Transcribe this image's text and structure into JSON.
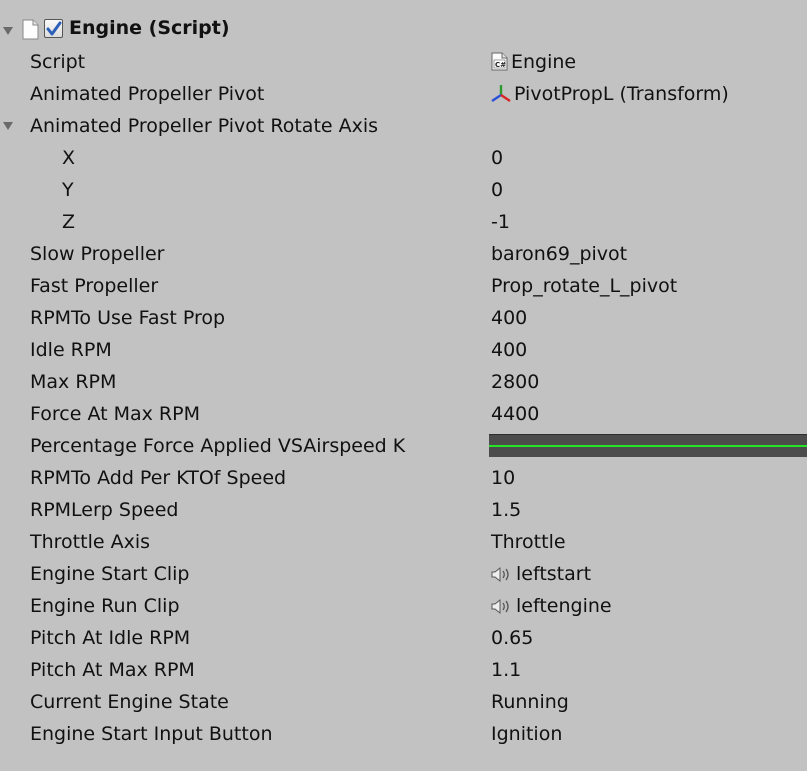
{
  "component": {
    "title": "Engine (Script)",
    "enabled": true,
    "icon": "file-icon",
    "checkbox_icon": "checkmark-icon"
  },
  "fields": {
    "script": {
      "label": "Script",
      "value": "Engine",
      "icon": "csharp-script-icon"
    },
    "pivot": {
      "label": "Animated Propeller Pivot",
      "value": "PivotPropL (Transform)",
      "icon": "transform-icon"
    },
    "rotate_axis": {
      "label": "Animated Propeller Pivot Rotate Axis"
    },
    "axis_x": {
      "label": "X",
      "value": "0"
    },
    "axis_y": {
      "label": "Y",
      "value": "0"
    },
    "axis_z": {
      "label": "Z",
      "value": "-1"
    },
    "slow_prop": {
      "label": "Slow Propeller",
      "value": "baron69_pivot"
    },
    "fast_prop": {
      "label": "Fast Propeller",
      "value": "Prop_rotate_L_pivot"
    },
    "rpm_fast_prop": {
      "label": "RPMTo Use Fast Prop",
      "value": "400"
    },
    "idle_rpm": {
      "label": "Idle RPM",
      "value": "400"
    },
    "max_rpm": {
      "label": "Max RPM",
      "value": "2800"
    },
    "force_max_rpm": {
      "label": "Force At Max RPM",
      "value": "4400"
    },
    "pct_force": {
      "label": "Percentage Force Applied VSAirspeed K",
      "curve_color": "#27e227"
    },
    "rpm_per_kt": {
      "label": "RPMTo Add Per KTOf Speed",
      "value": "10"
    },
    "rpm_lerp": {
      "label": "RPMLerp Speed",
      "value": "1.5"
    },
    "throttle_axis": {
      "label": "Throttle Axis",
      "value": "Throttle"
    },
    "start_clip": {
      "label": "Engine Start Clip",
      "value": "leftstart",
      "icon": "audio-clip-icon"
    },
    "run_clip": {
      "label": "Engine Run Clip",
      "value": "leftengine",
      "icon": "audio-clip-icon"
    },
    "pitch_idle": {
      "label": "Pitch At Idle RPM",
      "value": "0.65"
    },
    "pitch_max": {
      "label": "Pitch At Max RPM",
      "value": "1.1"
    },
    "engine_state": {
      "label": "Current Engine State",
      "value": "Running"
    },
    "start_button": {
      "label": "Engine Start Input Button",
      "value": "Ignition"
    }
  },
  "colors": {
    "panel": "#c2c2c2",
    "curve_bg": "#4c4c4c",
    "curve_line": "#27e227"
  }
}
